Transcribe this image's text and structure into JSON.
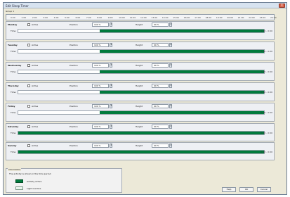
{
  "window": {
    "title": "Edit Sleep Timer",
    "close_label": "X"
  },
  "group": {
    "label": "Group 1"
  },
  "ruler": {
    "labels": [
      "0:00",
      "1:00",
      "2:00",
      "3:00",
      "4:00",
      "5:00",
      "6:00",
      "7:00",
      "8:00",
      "9:00",
      "10:00",
      "11:00",
      "12:00",
      "13:00",
      "14:00",
      "15:00",
      "16:00",
      "17:00",
      "18:00",
      "19:00",
      "20:00",
      "21:00",
      "22:00",
      "23:00",
      "24:00"
    ]
  },
  "days": [
    {
      "name": "Monday",
      "active_label": "Active",
      "position_label": "Position",
      "position_value": "100 %",
      "height_label": "Height",
      "height_value": "90 %",
      "time_label": "Time",
      "end_label": "0:00 - 0:00",
      "bar_start": 0.33,
      "bar_end": 1.0
    },
    {
      "name": "Tuesday",
      "active_label": "Active",
      "position_label": "Position",
      "position_value": "100 %",
      "height_label": "Height",
      "height_value": "90 %",
      "time_label": "Time",
      "end_label": "0:00 - 0:00",
      "bar_start": 0.33,
      "bar_end": 1.0
    },
    {
      "name": "Wednesday",
      "active_label": "Active",
      "position_label": "Position",
      "position_value": "100 %",
      "height_label": "Height",
      "height_value": "90 %",
      "time_label": "Time",
      "end_label": "0:00 - 0:00",
      "bar_start": 0.33,
      "bar_end": 1.0
    },
    {
      "name": "Thursday",
      "active_label": "Active",
      "position_label": "Position",
      "position_value": "100 %",
      "height_label": "Height",
      "height_value": "90 %",
      "time_label": "Time",
      "end_label": "0:00 - 0:00",
      "bar_start": 0.33,
      "bar_end": 1.0
    },
    {
      "name": "Friday",
      "active_label": "Active",
      "position_label": "Position",
      "position_value": "100 %",
      "height_label": "Height",
      "height_value": "90 %",
      "time_label": "Time",
      "end_label": "0:00 - 0:00",
      "bar_start": 0.33,
      "bar_end": 1.0
    },
    {
      "name": "Saturday",
      "active_label": "Active",
      "position_label": "Position",
      "position_value": "100 %",
      "height_label": "Height",
      "height_value": "90 %",
      "time_label": "Time",
      "end_label": "0:00 - 0:00",
      "bar_start": 0.0,
      "bar_end": 1.0
    },
    {
      "name": "Sunday",
      "active_label": "Active",
      "position_label": "Position",
      "position_value": "100 %",
      "height_label": "Height",
      "height_value": "90 %",
      "time_label": "Time",
      "end_label": "0:00 - 0:00",
      "bar_start": 0.0,
      "bar_end": 1.0
    }
  ],
  "info": {
    "title": "Information",
    "text": "The activity is shown in the time period.",
    "legend": [
      {
        "label": "Activity active",
        "color": "#007a3d"
      },
      {
        "label": "Light inactive",
        "color": "#e8f3ec"
      }
    ]
  },
  "buttons": {
    "help": "Help",
    "ok": "OK",
    "cancel": "Cancel"
  },
  "colors": {
    "bar": "#007a3d",
    "window_bg": "#ece9d8"
  }
}
